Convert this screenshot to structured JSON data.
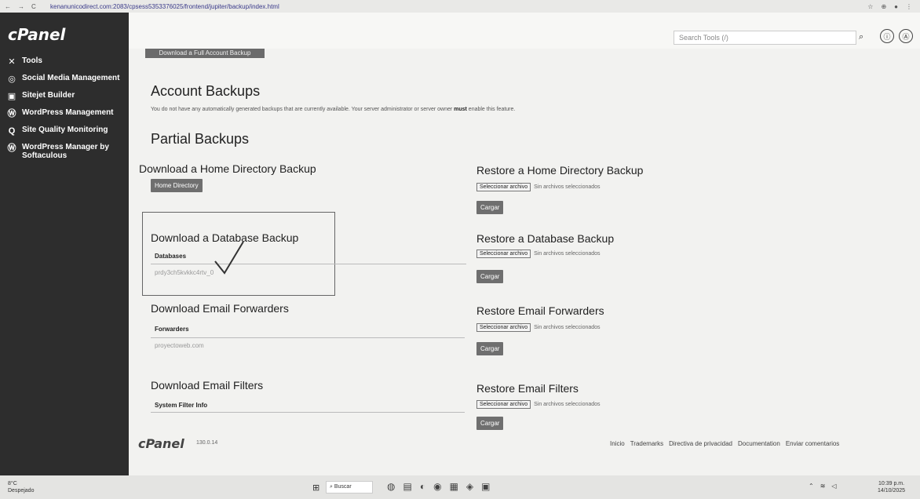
{
  "browser": {
    "url": "kenanunicodirect.com:2083/cpsess5353376025/frontend/jupiter/backup/index.html",
    "nav_icons": [
      "←",
      "→",
      "C"
    ]
  },
  "sidebar": {
    "logo": "cPanel",
    "items": [
      {
        "label": "Tools",
        "icon": "tools-icon",
        "glyph": "✕"
      },
      {
        "label": "Social Media Management",
        "icon": "social-icon",
        "glyph": "◎"
      },
      {
        "label": "Sitejet Builder",
        "icon": "sitejet-icon",
        "glyph": "▣"
      },
      {
        "label": "WordPress Management",
        "icon": "wordpress-icon",
        "glyph": "Ⓦ"
      },
      {
        "label": "Site Quality Monitoring",
        "icon": "quality-icon",
        "glyph": "Q"
      },
      {
        "label": "WordPress Manager by Softaculous",
        "icon": "wordpress-icon",
        "glyph": "Ⓦ"
      }
    ]
  },
  "header": {
    "search_placeholder": "Search Tools (/)",
    "help_glyph": "ⓘ",
    "user_glyph": "Ⓐ"
  },
  "main": {
    "top_button": "Download a Full Account Backup",
    "account_title": "Account Backups",
    "account_desc_pre": "You do not have any automatically generated backups that are currently available. Your server administrator or server owner ",
    "account_desc_bold": "must",
    "account_desc_post": " enable this feature.",
    "partial_title": "Partial Backups",
    "home_dl_title": "Download a Home Directory Backup",
    "home_dl_button": "Home Directory",
    "home_restore_title": "Restore a Home Directory Backup",
    "db_dl_title": "Download a Database Backup",
    "db_col": "Databases",
    "db_value": "prdy3ch5kvkkc4rtv_0",
    "db_restore_title": "Restore a Database Backup",
    "email_fwd_title": "Download Email Forwarders",
    "email_fwd_col": "Forwarders",
    "email_fwd_value": "proyectoweb.com",
    "email_fwd_restore_title": "Restore Email Forwarders",
    "email_filter_title": "Download Email Filters",
    "email_filter_col": "System Filter Info",
    "email_filter_restore_title": "Restore Email Filters",
    "file_button": "Seleccionar archivo",
    "file_none": "Sin archivos seleccionados",
    "upload_button": "Cargar"
  },
  "footer": {
    "logo": "cPanel",
    "version": "130.0.14",
    "links": [
      "Inicio",
      "Trademarks",
      "Directiva de privacidad",
      "Documentation",
      "Enviar comentarios"
    ]
  },
  "taskbar": {
    "weather_temp": "8°C",
    "weather_desc": "Despejado",
    "search": "Buscar",
    "time": "10:39 p.m.",
    "date": "14/10/2025"
  }
}
